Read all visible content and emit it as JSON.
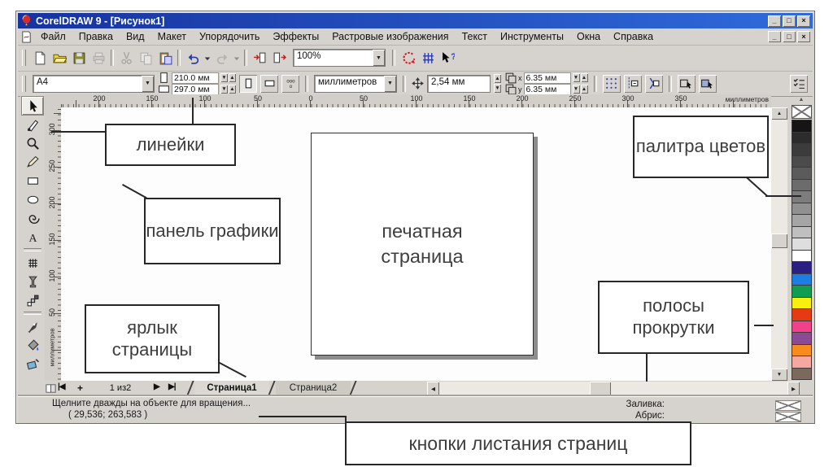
{
  "window": {
    "title": "CorelDRAW 9 - [Рисунок1]",
    "minimize": "_",
    "restore": "□",
    "close": "×"
  },
  "mdi": {
    "minimize": "_",
    "restore": "□",
    "close": "×"
  },
  "menu": {
    "items": [
      "Файл",
      "Правка",
      "Вид",
      "Макет",
      "Упорядочить",
      "Эффекты",
      "Растровые изображения",
      "Текст",
      "Инструменты",
      "Окна",
      "Справка"
    ]
  },
  "toolbar": {
    "zoom_value": "100%",
    "button_groups": [
      [
        {
          "name": "new-document-button",
          "icon": "new-icon"
        },
        {
          "name": "open-button",
          "icon": "open-icon"
        },
        {
          "name": "save-button",
          "icon": "save-icon"
        },
        {
          "name": "print-button",
          "icon": "print-icon",
          "disabled": true
        }
      ],
      [
        {
          "name": "cut-button",
          "icon": "cut-icon",
          "disabled": true
        },
        {
          "name": "copy-button",
          "icon": "copy-icon",
          "disabled": true
        },
        {
          "name": "paste-button",
          "icon": "paste-icon"
        }
      ],
      [
        {
          "name": "undo-button",
          "icon": "undo-icon"
        },
        {
          "name": "undo-dropdown-button",
          "icon": "chevron-down-icon",
          "narrow": true
        },
        {
          "name": "redo-button",
          "icon": "redo-icon",
          "disabled": true
        },
        {
          "name": "redo-dropdown-button",
          "icon": "chevron-down-icon",
          "disabled": true,
          "narrow": true
        }
      ],
      [
        {
          "name": "import-button",
          "icon": "import-icon"
        },
        {
          "name": "export-button",
          "icon": "export-icon"
        }
      ]
    ],
    "right_buttons": [
      {
        "name": "application-launcher-button",
        "icon": "launcher-icon"
      },
      {
        "name": "corel-online-button",
        "icon": "online-icon"
      },
      {
        "name": "whats-this-help-button",
        "icon": "help-cursor-icon"
      }
    ]
  },
  "property_bar": {
    "paper_size": "A4",
    "page_width": "210.0 мм",
    "page_height": "297.0 мм",
    "units": "миллиметров",
    "nudge": "2,54 мм",
    "duplicate_x": "6.35 мм",
    "duplicate_y": "6.35 мм",
    "dup_x_letter": "x",
    "dup_y_letter": "y"
  },
  "spinner": {
    "down": "▼",
    "up": "▲"
  },
  "toolbox": {
    "active_index": 0,
    "group_breaks": [
      8,
      11
    ],
    "tools": [
      {
        "name": "pick-tool",
        "icon": "pick-icon"
      },
      {
        "name": "shape-tool",
        "icon": "shape-icon"
      },
      {
        "name": "zoom-tool",
        "icon": "zoom-icon"
      },
      {
        "name": "freehand-tool",
        "icon": "freehand-icon"
      },
      {
        "name": "rectangle-tool",
        "icon": "rectangle-icon"
      },
      {
        "name": "ellipse-tool",
        "icon": "ellipse-icon"
      },
      {
        "name": "spiral-tool",
        "icon": "spiral-icon"
      },
      {
        "name": "text-tool",
        "icon": "text-icon"
      },
      {
        "name": "interactive-distortion-tool",
        "icon": "distortion-icon"
      },
      {
        "name": "interactive-transparency-tool",
        "icon": "transparency-icon"
      },
      {
        "name": "interactive-blend-tool",
        "icon": "blend-icon"
      },
      {
        "name": "outline-tool",
        "icon": "outline-icon"
      },
      {
        "name": "fill-tool",
        "icon": "fill-icon"
      },
      {
        "name": "interactive-fill-tool",
        "icon": "interactive-fill-icon"
      }
    ]
  },
  "rulers": {
    "top_labels": [
      "200",
      "150",
      "100",
      "50",
      "0",
      "50",
      "100",
      "150",
      "200",
      "250",
      "300",
      "350"
    ],
    "left_labels": [
      "300",
      "250",
      "200",
      "150",
      "100",
      "50"
    ],
    "unit_label": "миллиметров"
  },
  "palette": {
    "colors": [
      "#151515",
      "#2c2c2c",
      "#3c3c3c",
      "#4b4b4b",
      "#5b5b5b",
      "#6c6c6c",
      "#7d7d7d",
      "#909090",
      "#a5a5a5",
      "#bfbfbf",
      "#dedede",
      "#ffffff",
      "#2a2083",
      "#1e7de2",
      "#0f9e51",
      "#f8ef0e",
      "#e63a14",
      "#f2418a",
      "#8d4a94",
      "#f78c1e",
      "#f5a7a0",
      "#7c695b"
    ]
  },
  "page_nav": {
    "first": "|◀",
    "add_page": "+",
    "counter": "1 из2",
    "next": "▶",
    "last": "▶|",
    "tabs": [
      {
        "label": "Страница1",
        "active": true
      },
      {
        "label": "Страница2",
        "active": false
      }
    ]
  },
  "scrollbars": {
    "up": "▲",
    "down": "▼",
    "left": "◀",
    "right": "▶",
    "expand": "◀"
  },
  "status_bar": {
    "hint": "Щелните дважды на объекте для вращения...",
    "coordinates": "( 29,536; 263,583 )",
    "fill_label": "Заливка:",
    "outline_label": "Абрис:"
  },
  "callouts": {
    "rulers": "линейки",
    "toolbox": "панель графики",
    "page": "печатная страница",
    "palette": "палитра цветов",
    "scrollbars": "полосы прокрутки",
    "page_tab": "ярлык страницы",
    "page_buttons": "кнопки листания страниц"
  }
}
